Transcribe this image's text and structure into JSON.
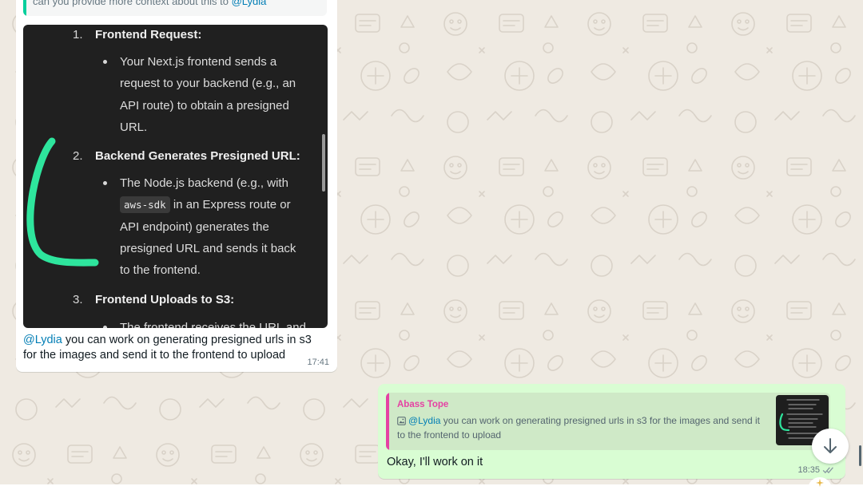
{
  "incoming": {
    "quoted_text_prefix": "can you provide more context about this to ",
    "quoted_mention": "@Lydia",
    "image": {
      "step1_num": "1.",
      "step1_title": "Frontend Request:",
      "step1_lines": [
        "Your Next.js frontend sends a",
        "request to your backend (e.g., an",
        "API route) to obtain a presigned",
        "URL."
      ],
      "step2_num": "2.",
      "step2_title": "Backend Generates Presigned URL:",
      "step2_line1": "The Node.js backend (e.g., with",
      "step2_code": "aws-sdk",
      "step2_line2_rest": " in an Express route or",
      "step2_lines_after": [
        "API endpoint) generates the",
        "presigned URL and sends it back",
        "to the frontend."
      ],
      "step3_num": "3.",
      "step3_title": "Frontend Uploads to S3:",
      "step3_line1": "The frontend receives the URL and",
      "annotation_color": "#2ee59d"
    },
    "caption_mention": "@Lydia",
    "caption_text": " you can work on generating presigned urls in s3 for the images and send it to the frontend to upload",
    "time": "17:41"
  },
  "outgoing": {
    "reply_author": "Abass Tope",
    "reply_mention": "@Lydia",
    "reply_text": " you can work on generating presigned urls in s3 for the images and send it to the frontend to upload",
    "text": "Okay, I'll work on it",
    "time": "18:35",
    "status": "read"
  },
  "icons": {
    "scroll_down": "arrow-down-icon",
    "reply_image": "image-icon",
    "read_receipt": "double-check-icon",
    "react": "emoji-react-icon"
  },
  "colors": {
    "chat_background": "#efeae2",
    "incoming_bubble": "#ffffff",
    "outgoing_bubble": "#d9fdd3",
    "mention": "#027eb5",
    "reply_author": "#e542a3",
    "quote_bar": "#06cf9c"
  }
}
